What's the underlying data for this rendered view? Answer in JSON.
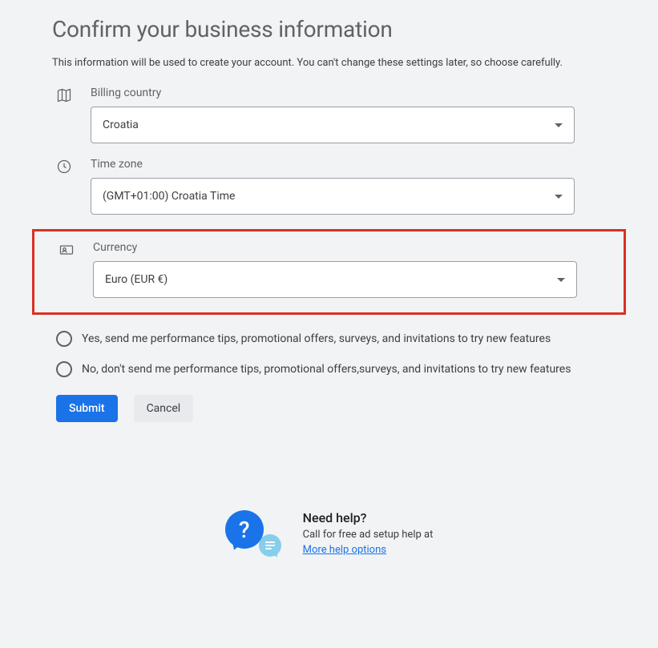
{
  "heading": "Confirm your business information",
  "description": "This information will be used to create your account. You can't change these settings later, so choose carefully.",
  "fields": {
    "billing_country": {
      "label": "Billing country",
      "value": "Croatia"
    },
    "time_zone": {
      "label": "Time zone",
      "value": "(GMT+01:00) Croatia Time"
    },
    "currency": {
      "label": "Currency",
      "value": "Euro (EUR €)"
    }
  },
  "radio": {
    "yes": "Yes, send me performance tips, promotional offers, surveys, and invitations to try new features",
    "no": "No, don't send me performance tips, promotional offers,surveys, and invitations to try new features"
  },
  "buttons": {
    "submit": "Submit",
    "cancel": "Cancel"
  },
  "help": {
    "title": "Need help?",
    "text": "Call for free ad setup help at",
    "link": "More help options"
  }
}
